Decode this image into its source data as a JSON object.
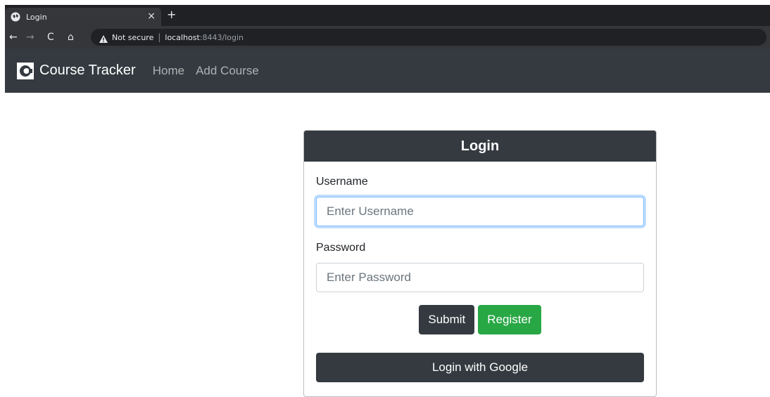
{
  "browser": {
    "tab_title": "Login",
    "tab_close": "×",
    "new_tab": "+",
    "back": "←",
    "forward": "→",
    "reload": "C",
    "home": "⌂",
    "security_label": "Not secure",
    "separator": "|",
    "url_host": "localhost",
    "url_rest": ":8443/login"
  },
  "navbar": {
    "brand": "Course Tracker",
    "links": [
      "Home",
      "Add Course"
    ]
  },
  "login": {
    "title": "Login",
    "username_label": "Username",
    "username_placeholder": "Enter Username",
    "username_value": "",
    "password_label": "Password",
    "password_placeholder": "Enter Password",
    "password_value": "",
    "submit_label": "Submit",
    "register_label": "Register",
    "google_label": "Login with Google"
  },
  "colors": {
    "navbar_bg": "#343a40",
    "success": "#28a745",
    "focus_border": "#80bdff"
  }
}
